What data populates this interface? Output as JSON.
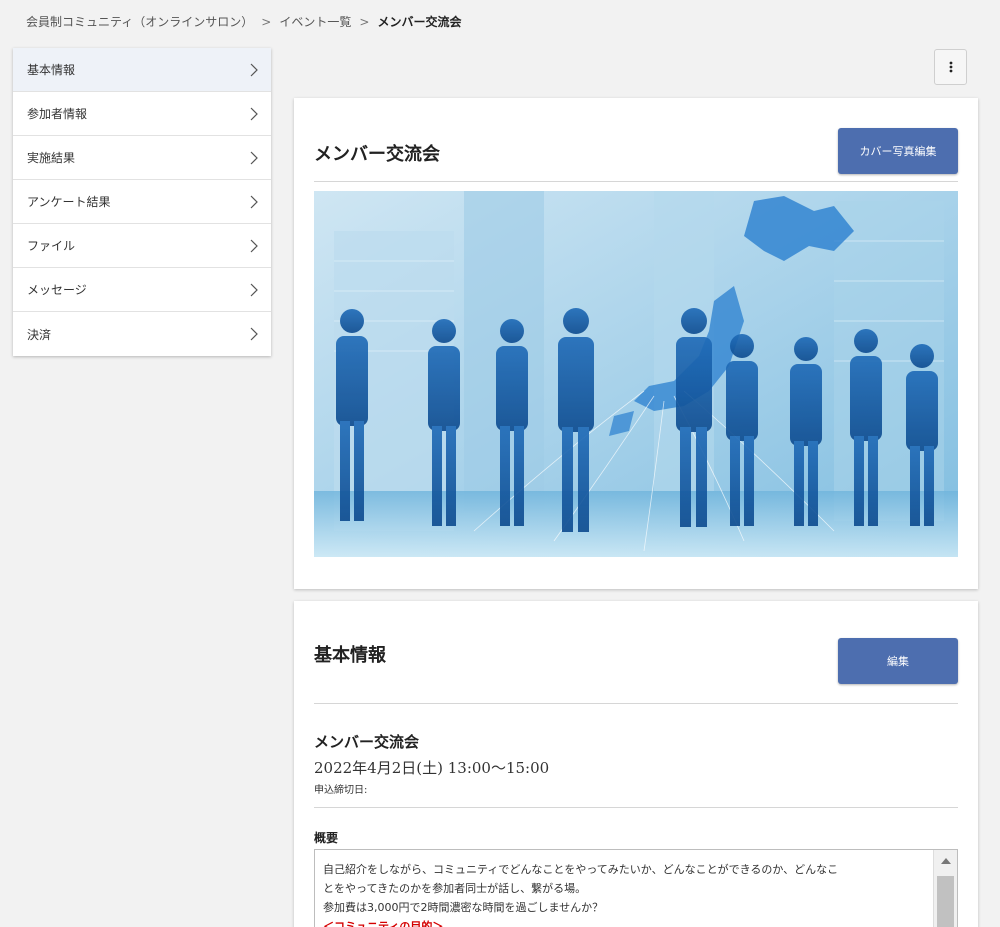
{
  "breadcrumb": {
    "items": [
      "会員制コミュニティ（オンラインサロン）",
      "イベント一覧"
    ],
    "separator": ">",
    "current": "メンバー交流会"
  },
  "sidebar": {
    "items": [
      {
        "label": "基本情報",
        "active": true
      },
      {
        "label": "参加者情報"
      },
      {
        "label": "実施結果"
      },
      {
        "label": "アンケート結果"
      },
      {
        "label": "ファイル"
      },
      {
        "label": "メッセージ"
      },
      {
        "label": "決済"
      }
    ]
  },
  "menu": {
    "icon": "kebab-vertical-icon"
  },
  "cover_card": {
    "title": "メンバー交流会",
    "edit_cover_label": "カバー写真編集",
    "image": "business-people-silhouettes-map-image"
  },
  "info_card": {
    "title": "基本情報",
    "edit_label": "編集",
    "event_name": "メンバー交流会",
    "event_date": "2022年4月2日(土) 13:00〜15:00",
    "deadline_label": "申込締切日:",
    "summary_label": "概要",
    "summary_lines": [
      "自己紹介をしながら、コミュニティでどんなことをやってみたいか、どんなことができるのか、どんなこ",
      "とをやってきたのかを参加者同士が話し、繋がる場。",
      "参加費は3,000円で2時間濃密な時間を過ごしませんか？"
    ],
    "summary_highlight": "＜コミュニティの目的＞"
  },
  "colors": {
    "primary_button": "#4d6eaf",
    "highlight_text": "#d40000",
    "background": "#f2f2f2"
  }
}
